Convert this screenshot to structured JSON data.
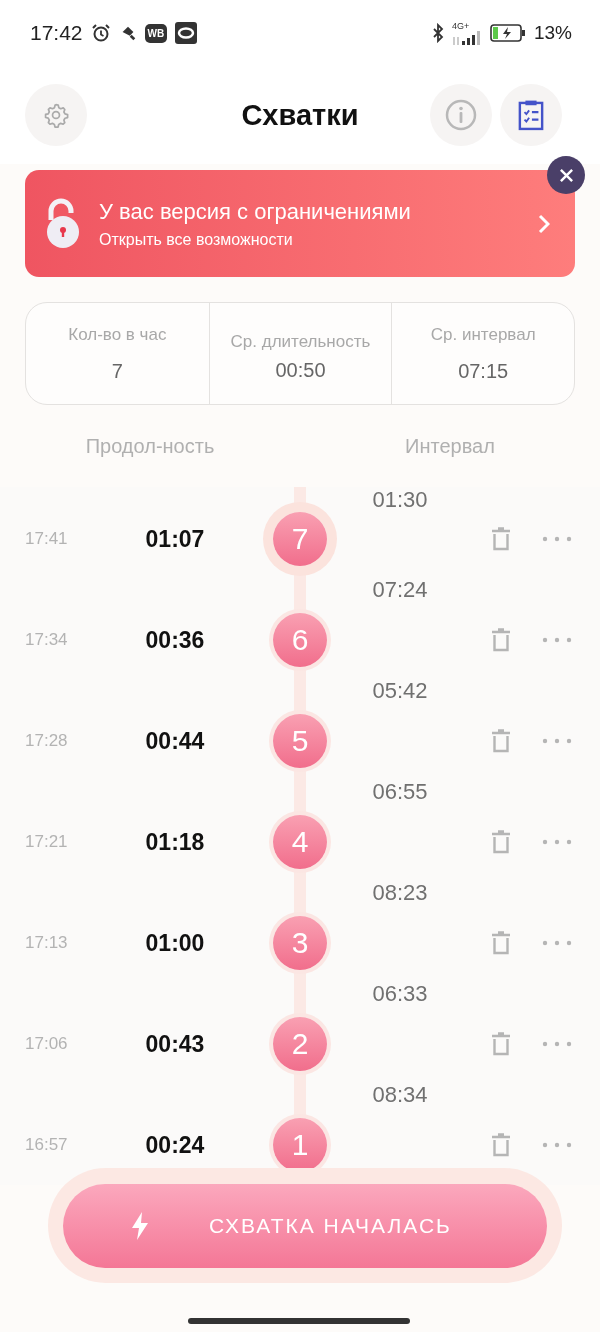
{
  "status_bar": {
    "time": "17:42",
    "badges": [
      "WB"
    ],
    "network": "4G+",
    "battery": "13%"
  },
  "header": {
    "title": "Схватки"
  },
  "banner": {
    "title": "У вас версия с ограничениями",
    "subtitle": "Открыть все возможности"
  },
  "stats": [
    {
      "label": "Кол-во в час",
      "value": "7"
    },
    {
      "label": "Ср. длительность",
      "value": "00:50"
    },
    {
      "label": "Ср. интервал",
      "value": "07:15"
    }
  ],
  "columns": {
    "duration": "Продол-ность",
    "interval": "Интервал"
  },
  "top_interval": "01:30",
  "contractions": [
    {
      "time": "17:41",
      "duration": "01:07",
      "number": "7",
      "active": true,
      "interval_after": "07:24"
    },
    {
      "time": "17:34",
      "duration": "00:36",
      "number": "6",
      "active": false,
      "interval_after": "05:42"
    },
    {
      "time": "17:28",
      "duration": "00:44",
      "number": "5",
      "active": false,
      "interval_after": "06:55"
    },
    {
      "time": "17:21",
      "duration": "01:18",
      "number": "4",
      "active": false,
      "interval_after": "08:23"
    },
    {
      "time": "17:13",
      "duration": "01:00",
      "number": "3",
      "active": false,
      "interval_after": "06:33"
    },
    {
      "time": "17:06",
      "duration": "00:43",
      "number": "2",
      "active": false,
      "interval_after": "08:34"
    },
    {
      "time": "16:57",
      "duration": "00:24",
      "number": "1",
      "active": false
    }
  ],
  "start_button": {
    "label": "СХВАТКА НАЧАЛАСЬ"
  }
}
